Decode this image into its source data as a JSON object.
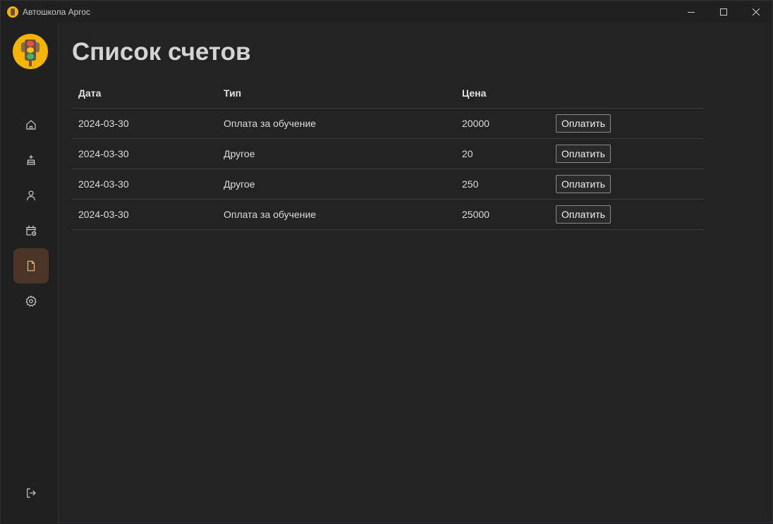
{
  "window": {
    "title": "Автошкола Аргос",
    "controls": [
      "minimize",
      "maximize",
      "close"
    ]
  },
  "sidebar": {
    "logo_icon": "traffic-light-icon",
    "items": [
      {
        "id": "home",
        "icon": "home-icon",
        "active": false
      },
      {
        "id": "driving",
        "icon": "driver-icon",
        "active": false
      },
      {
        "id": "profile",
        "icon": "user-icon",
        "active": false
      },
      {
        "id": "schedule",
        "icon": "calendar-clock-icon",
        "active": false
      },
      {
        "id": "bills",
        "icon": "document-icon",
        "active": true
      },
      {
        "id": "settings",
        "icon": "gear-icon",
        "active": false
      }
    ],
    "logout_icon": "logout-icon",
    "active_color": "#4a3527"
  },
  "main": {
    "title": "Список счетов",
    "table": {
      "headers": [
        "Дата",
        "Тип",
        "Цена",
        ""
      ],
      "rows": [
        {
          "date": "2024-03-30",
          "type": "Оплата за обучение",
          "price": "20000",
          "action": "Оплатить"
        },
        {
          "date": "2024-03-30",
          "type": "Другое",
          "price": "20",
          "action": "Оплатить"
        },
        {
          "date": "2024-03-30",
          "type": "Другое",
          "price": "250",
          "action": "Оплатить"
        },
        {
          "date": "2024-03-30",
          "type": "Оплата за обучение",
          "price": "25000",
          "action": "Оплатить"
        }
      ]
    }
  },
  "colors": {
    "background": "#232323",
    "sidebar": "#202020",
    "accent_logo": "#f5b400"
  }
}
